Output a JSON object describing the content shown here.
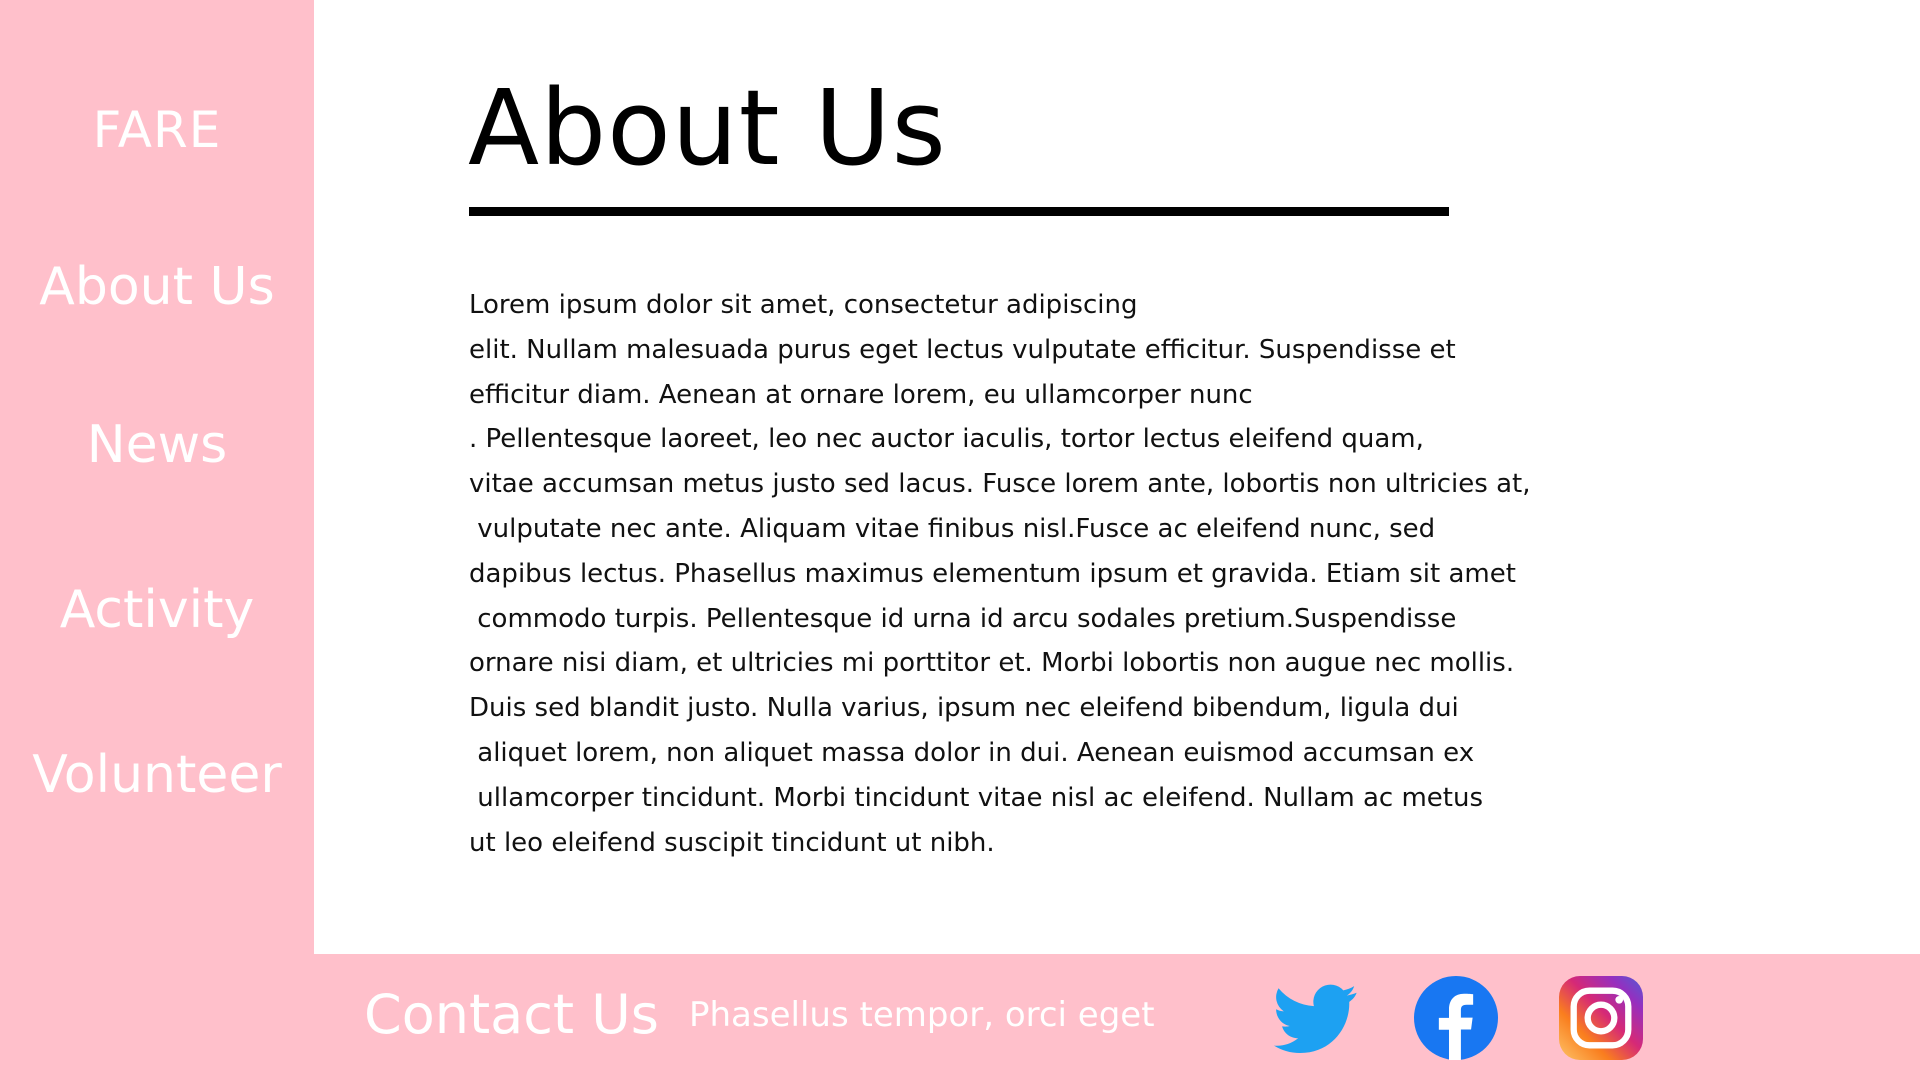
{
  "sidebar": {
    "brand": "FARE",
    "items": [
      {
        "label": "About Us"
      },
      {
        "label": "News"
      },
      {
        "label": "Activity"
      },
      {
        "label": "Volunteer"
      }
    ]
  },
  "main": {
    "title": "About Us",
    "paragraph_lines": [
      "Lorem ipsum dolor sit amet, consectetur adipiscing",
      "elit. Nullam malesuada purus eget lectus vulputate efficitur. Suspendisse et",
      "efficitur diam. Aenean at ornare lorem, eu ullamcorper nunc",
      ". Pellentesque laoreet, leo nec auctor iaculis, tortor lectus eleifend quam,",
      "vitae accumsan metus justo sed lacus. Fusce lorem ante, lobortis non ultricies at,",
      " vulputate nec ante. Aliquam vitae finibus nisl.Fusce ac eleifend nunc, sed",
      "dapibus lectus. Phasellus maximus elementum ipsum et gravida. Etiam sit amet",
      " commodo turpis. Pellentesque id urna id arcu sodales pretium.Suspendisse",
      "ornare nisi diam, et ultricies mi porttitor et. Morbi lobortis non augue nec mollis.",
      "Duis sed blandit justo. Nulla varius, ipsum nec eleifend bibendum, ligula dui",
      " aliquet lorem, non aliquet massa dolor in dui. Aenean euismod accumsan ex",
      " ullamcorper tincidunt. Morbi tincidunt vitae nisl ac eleifend. Nullam ac metus",
      "ut leo eleifend suscipit tincidunt ut nibh."
    ]
  },
  "footer": {
    "contact_title": "Contact Us",
    "contact_text": "Phasellus tempor, orci eget",
    "social": [
      {
        "icon": "twitter-icon"
      },
      {
        "icon": "facebook-icon"
      },
      {
        "icon": "instagram-icon"
      }
    ]
  },
  "colors": {
    "accent_pink": "#ffc0cb",
    "twitter_blue": "#1da1f2",
    "facebook_blue": "#1877f2"
  }
}
